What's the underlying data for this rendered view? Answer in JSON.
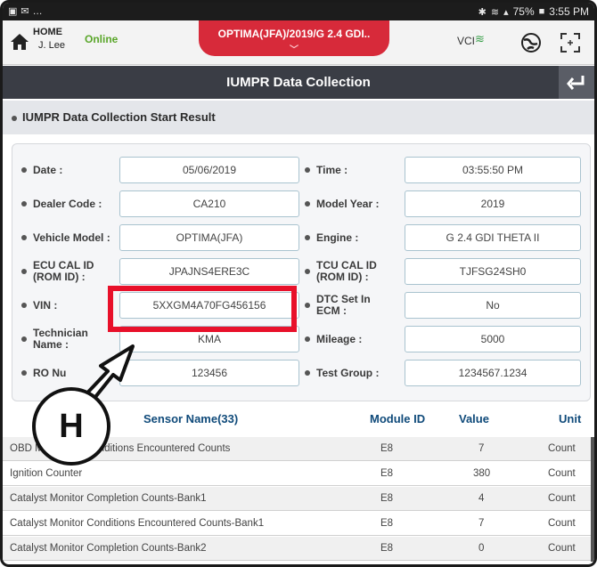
{
  "statusbar": {
    "battery": "75%",
    "time": "3:55 PM"
  },
  "header": {
    "home_label": "HOME",
    "user": "J. Lee",
    "status": "Online",
    "vehicle": "OPTIMA(JFA)/2019/G 2.4 GDI..",
    "vci_label": "VCI"
  },
  "title": "IUMPR Data Collection",
  "section": "IUMPR Data Collection Start Result",
  "fields": {
    "date_label": "Date :",
    "date": "05/06/2019",
    "time_label": "Time :",
    "time": "03:55:50 PM",
    "dealer_label": "Dealer Code :",
    "dealer": "CA210",
    "model_year_label": "Model Year :",
    "model_year": "2019",
    "vehicle_model_label": "Vehicle Model :",
    "vehicle_model": "OPTIMA(JFA)",
    "engine_label": "Engine :",
    "engine": "G 2.4 GDI THETA II",
    "ecu_label": "ECU CAL ID (ROM ID) :",
    "ecu": "JPAJNS4ERE3C",
    "tcu_label": "TCU CAL ID (ROM ID) :",
    "tcu": "TJFSG24SH0",
    "vin_label": "VIN :",
    "vin": "5XXGM4A70FG456156",
    "dtc_label": "DTC Set In ECM :",
    "dtc": "No",
    "tech_label": "Technician Name :",
    "tech": "KMA",
    "mileage_label": "Mileage :",
    "mileage": "5000",
    "ro_label": "RO Nu",
    "ro": "123456",
    "test_group_label": "Test Group :",
    "test_group": "1234567.1234"
  },
  "callout": "H",
  "table": {
    "headers": {
      "sensor": "Sensor Name(33)",
      "module": "Module ID",
      "value": "Value",
      "unit": "Unit"
    },
    "rows": [
      {
        "sensor": "OBD Monitoring Conditions Encountered Counts",
        "module": "E8",
        "value": "7",
        "unit": "Count"
      },
      {
        "sensor": "Ignition Counter",
        "module": "E8",
        "value": "380",
        "unit": "Count"
      },
      {
        "sensor": "Catalyst Monitor Completion Counts-Bank1",
        "module": "E8",
        "value": "4",
        "unit": "Count"
      },
      {
        "sensor": "Catalyst Monitor Conditions Encountered Counts-Bank1",
        "module": "E8",
        "value": "7",
        "unit": "Count"
      },
      {
        "sensor": "Catalyst Monitor Completion Counts-Bank2",
        "module": "E8",
        "value": "0",
        "unit": "Count"
      }
    ]
  },
  "colors": {
    "accent_red": "#d72a3a",
    "highlight": "#e8102a",
    "online": "#5aa62a",
    "header_text": "#0f4a7a"
  }
}
